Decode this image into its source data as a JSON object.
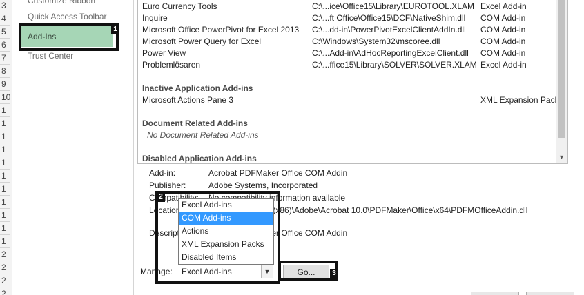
{
  "row_gutter": [
    "3",
    "4",
    "5",
    "6",
    "7",
    "8",
    "9",
    "10",
    "1",
    "1",
    "1",
    "1",
    "1",
    "1",
    "1",
    "1",
    "1",
    "1",
    "1",
    "2",
    "2",
    "2",
    "2"
  ],
  "nav": {
    "items": [
      "Customize Ribbon",
      "Quick Access Toolbar",
      "Add-Ins",
      "Trust Center"
    ],
    "badge": "1"
  },
  "addins_list": {
    "active_rows": [
      {
        "name": "Euro Currency Tools",
        "location": "C:\\...ice\\Office15\\Library\\EUROTOOL.XLAM",
        "type": "Excel Add-in"
      },
      {
        "name": "Inquire",
        "location": "C:\\...ft Office\\Office15\\DCF\\NativeShim.dll",
        "type": "COM Add-in"
      },
      {
        "name": "Microsoft Office PowerPivot for Excel 2013",
        "location": "C:\\...dd-in\\PowerPivotExcelClientAddIn.dll",
        "type": "COM Add-in"
      },
      {
        "name": "Microsoft Power Query for Excel",
        "location": "C:\\Windows\\System32\\mscoree.dll",
        "type": "COM Add-in"
      },
      {
        "name": "Power View",
        "location": "C:\\...Add-in\\AdHocReportingExcelClient.dll",
        "type": "COM Add-in"
      },
      {
        "name": "Problemlösaren",
        "location": "C:\\...ffice15\\Library\\SOLVER\\SOLVER.XLAM",
        "type": "Excel Add-in"
      }
    ],
    "inactive_header": "Inactive Application Add-ins",
    "inactive_rows": [
      {
        "name": "Microsoft Actions Pane 3",
        "location": "",
        "type": "XML Expansion Pack"
      }
    ],
    "doc_header": "Document Related Add-ins",
    "doc_none": "No Document Related Add-ins",
    "disabled_header": "Disabled Application Add-ins"
  },
  "details": {
    "addin_label": "Add-in:",
    "addin_value": "Acrobat PDFMaker Office COM Addin",
    "publisher_label": "Publisher:",
    "publisher_value": "Adobe Systems, Incorporated",
    "compat_label": "Compatibility:",
    "compat_value": "No compatibility information available",
    "location_label": "Location:",
    "location_value": "C:\\Program Files (x86)\\Adobe\\Acrobat 10.0\\PDFMaker\\Office\\x64\\PDFMOfficeAddin.dll",
    "description_label": "Description:",
    "description_value": "Acrobat PDFMaker Office COM Addin"
  },
  "manage": {
    "label": "Manage:",
    "selected": "Excel Add-ins",
    "options": [
      "Excel Add-ins",
      "COM Add-ins",
      "Actions",
      "XML Expansion Packs",
      "Disabled Items"
    ],
    "highlighted_index": 1,
    "badge": "2"
  },
  "go_button": {
    "label": "Go...",
    "badge": "3"
  },
  "colors": {
    "nav_selected": "#a6d6b6",
    "dropdown_highlight": "#3399ff",
    "annotation": "#111111"
  }
}
